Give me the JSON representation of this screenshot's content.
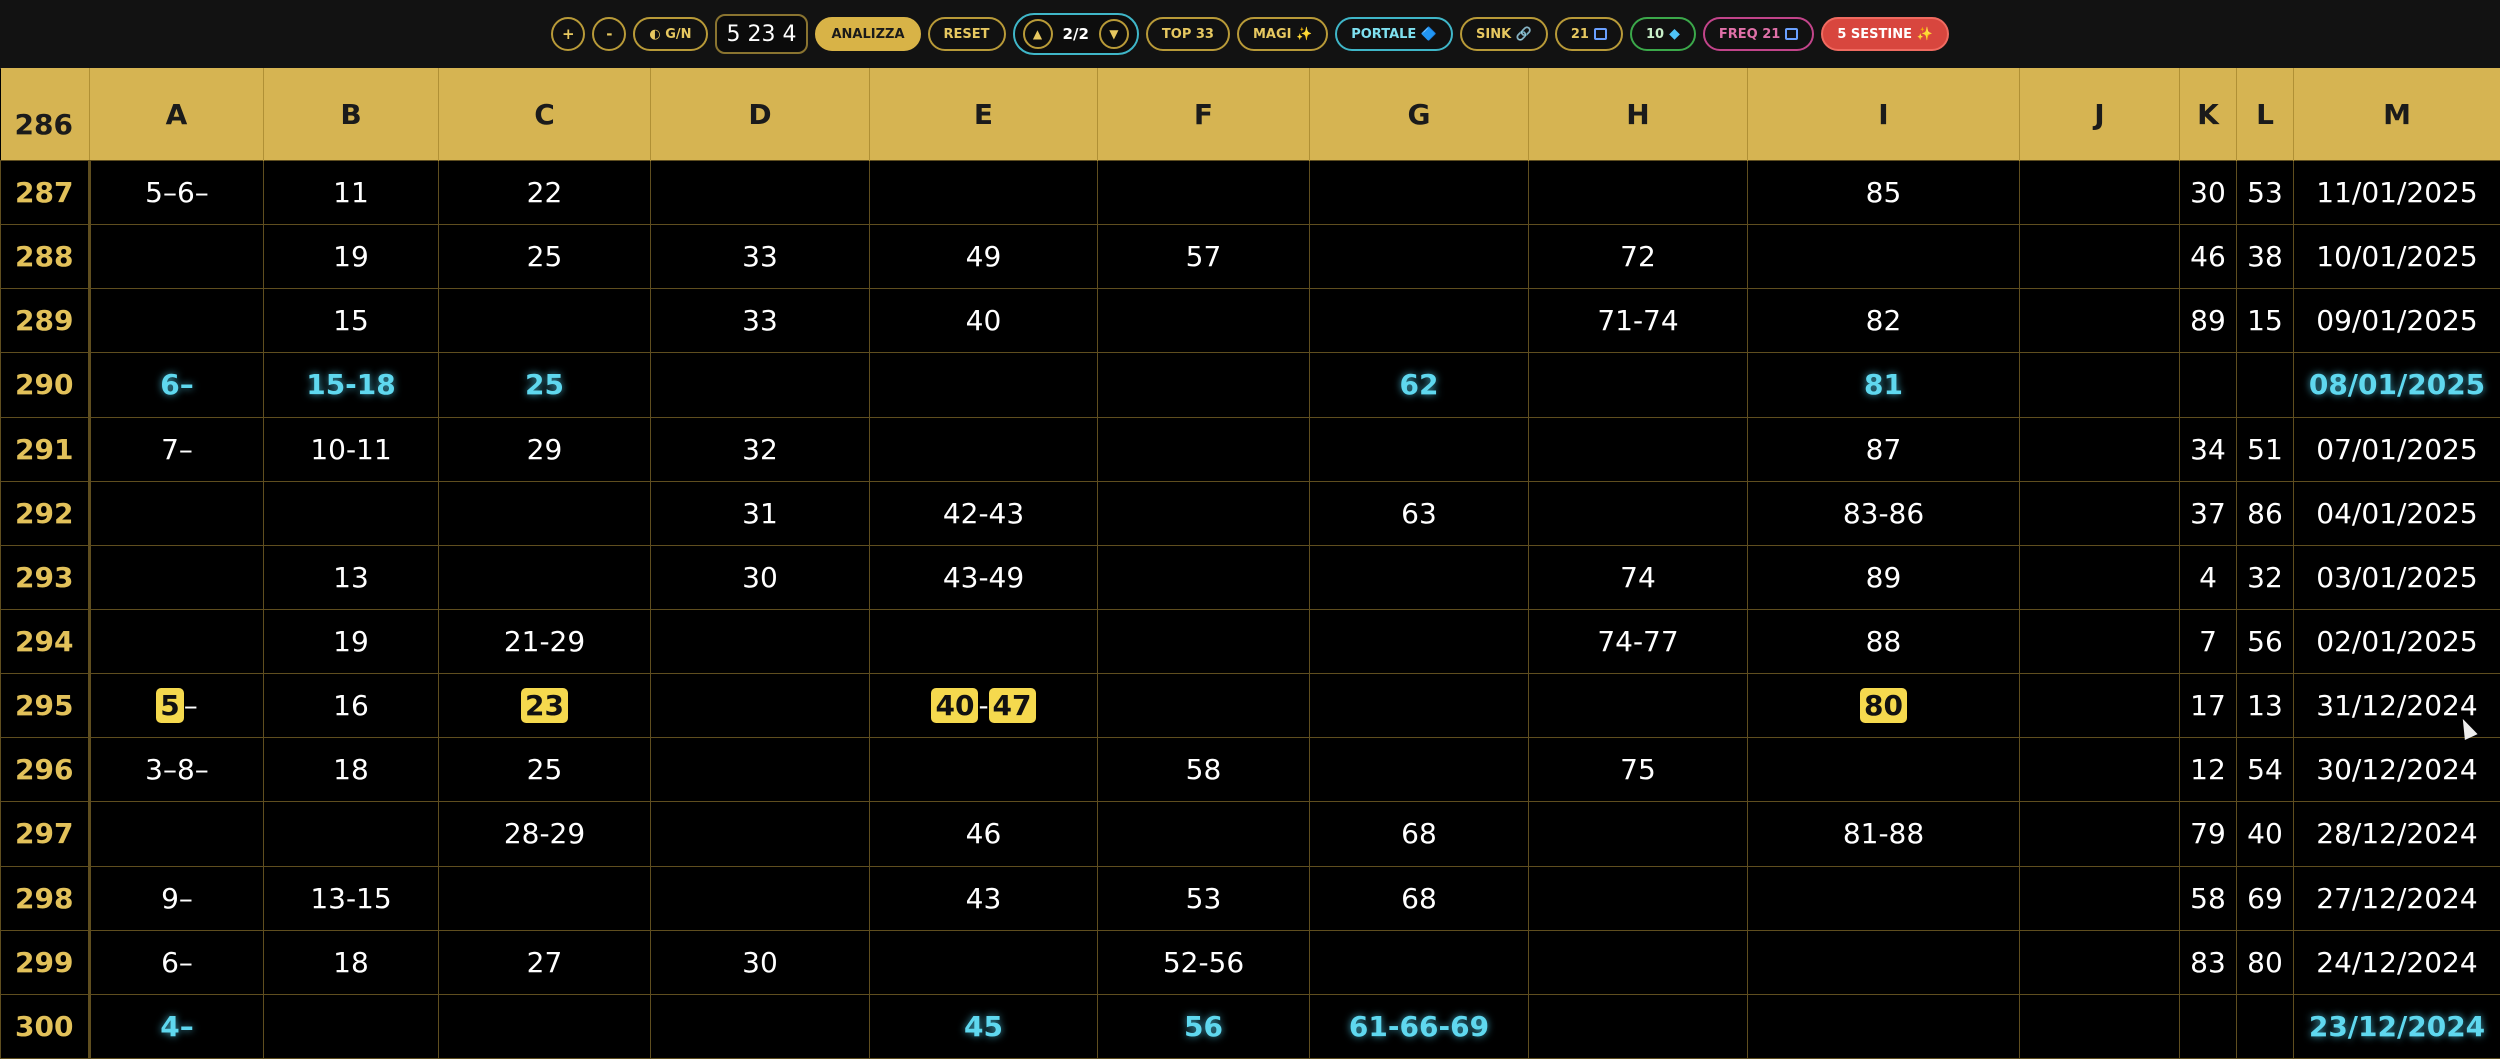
{
  "toolbar": {
    "zoom_in": "+",
    "zoom_out": "-",
    "theme_toggle": "◐ G/N",
    "numbers_display": "5 23 4",
    "analizza": "ANALIZZA",
    "reset": "RESET",
    "nav_up": "▲",
    "nav_count": "2/2",
    "nav_down": "▼",
    "top33": "TOP 33",
    "magi": "MAGI ✨",
    "portale": "PORTALE 🔷",
    "sink": "SINK 🔗",
    "btn21": "21",
    "btn10": "10",
    "freq21": "FREQ 21",
    "sestine": "5 SESTINE ✨"
  },
  "table": {
    "header_rownum": "286",
    "columns": [
      "A",
      "B",
      "C",
      "D",
      "E",
      "F",
      "G",
      "H",
      "I",
      "J",
      "K",
      "L",
      "M"
    ],
    "rows": [
      {
        "n": "287",
        "style": "normal",
        "cells": [
          "5–6–",
          "11",
          "22",
          "",
          "",
          "",
          "",
          "",
          "85",
          "",
          "30",
          "53",
          "11/01/2025"
        ]
      },
      {
        "n": "288",
        "style": "normal",
        "cells": [
          "",
          "19",
          "25",
          "33",
          "49",
          "57",
          "",
          "72",
          "",
          "",
          "46",
          "38",
          "10/01/2025"
        ]
      },
      {
        "n": "289",
        "style": "normal",
        "cells": [
          "",
          "15",
          "",
          "33",
          "40",
          "",
          "",
          "71-74",
          "82",
          "",
          "89",
          "15",
          "09/01/2025"
        ]
      },
      {
        "n": "290",
        "style": "blue",
        "cells": [
          "6–",
          "15-18",
          "25",
          "",
          "",
          "",
          "62",
          "",
          "81",
          "",
          "",
          "",
          "08/01/2025"
        ]
      },
      {
        "n": "291",
        "style": "normal",
        "cells": [
          "7–",
          "10-11",
          "29",
          "32",
          "",
          "",
          "",
          "",
          "87",
          "",
          "34",
          "51",
          "07/01/2025"
        ]
      },
      {
        "n": "292",
        "style": "normal",
        "cells": [
          "",
          "",
          "",
          "31",
          "42-43",
          "",
          "63",
          "",
          "83-86",
          "",
          "37",
          "86",
          "04/01/2025"
        ]
      },
      {
        "n": "293",
        "style": "normal",
        "cells": [
          "",
          "13",
          "",
          "30",
          "43-49",
          "",
          "",
          "74",
          "89",
          "",
          "4",
          "32",
          "03/01/2025"
        ]
      },
      {
        "n": "294",
        "style": "normal",
        "cells": [
          "",
          "19",
          "21-29",
          "",
          "",
          "",
          "",
          "74-77",
          "88",
          "",
          "7",
          "56",
          "02/01/2025"
        ]
      },
      {
        "n": "295",
        "style": "normal",
        "cells": [
          "5–",
          "16",
          "23",
          "",
          "40-47",
          "",
          "",
          "",
          "80",
          "",
          "17",
          "13",
          "31/12/2024"
        ]
      },
      {
        "n": "296",
        "style": "normal",
        "cells": [
          "3–8–",
          "18",
          "25",
          "",
          "",
          "58",
          "",
          "75",
          "",
          "",
          "12",
          "54",
          "30/12/2024"
        ]
      },
      {
        "n": "297",
        "style": "normal",
        "cells": [
          "",
          "",
          "28-29",
          "",
          "46",
          "",
          "68",
          "",
          "81-88",
          "",
          "79",
          "40",
          "28/12/2024"
        ]
      },
      {
        "n": "298",
        "style": "normal",
        "cells": [
          "9–",
          "13-15",
          "",
          "",
          "43",
          "53",
          "68",
          "",
          "",
          "",
          "58",
          "69",
          "27/12/2024"
        ]
      },
      {
        "n": "299",
        "style": "normal",
        "cells": [
          "6–",
          "18",
          "27",
          "30",
          "",
          "52-56",
          "",
          "",
          "",
          "",
          "83",
          "80",
          "24/12/2024"
        ]
      },
      {
        "n": "300",
        "style": "blue",
        "cells": [
          "4–",
          "",
          "",
          "",
          "45",
          "56",
          "61-66-69",
          "",
          "",
          "",
          "",
          "",
          "23/12/2024"
        ]
      }
    ],
    "highlight_numbers": [
      "5",
      "23",
      "40",
      "47",
      "80"
    ]
  }
}
